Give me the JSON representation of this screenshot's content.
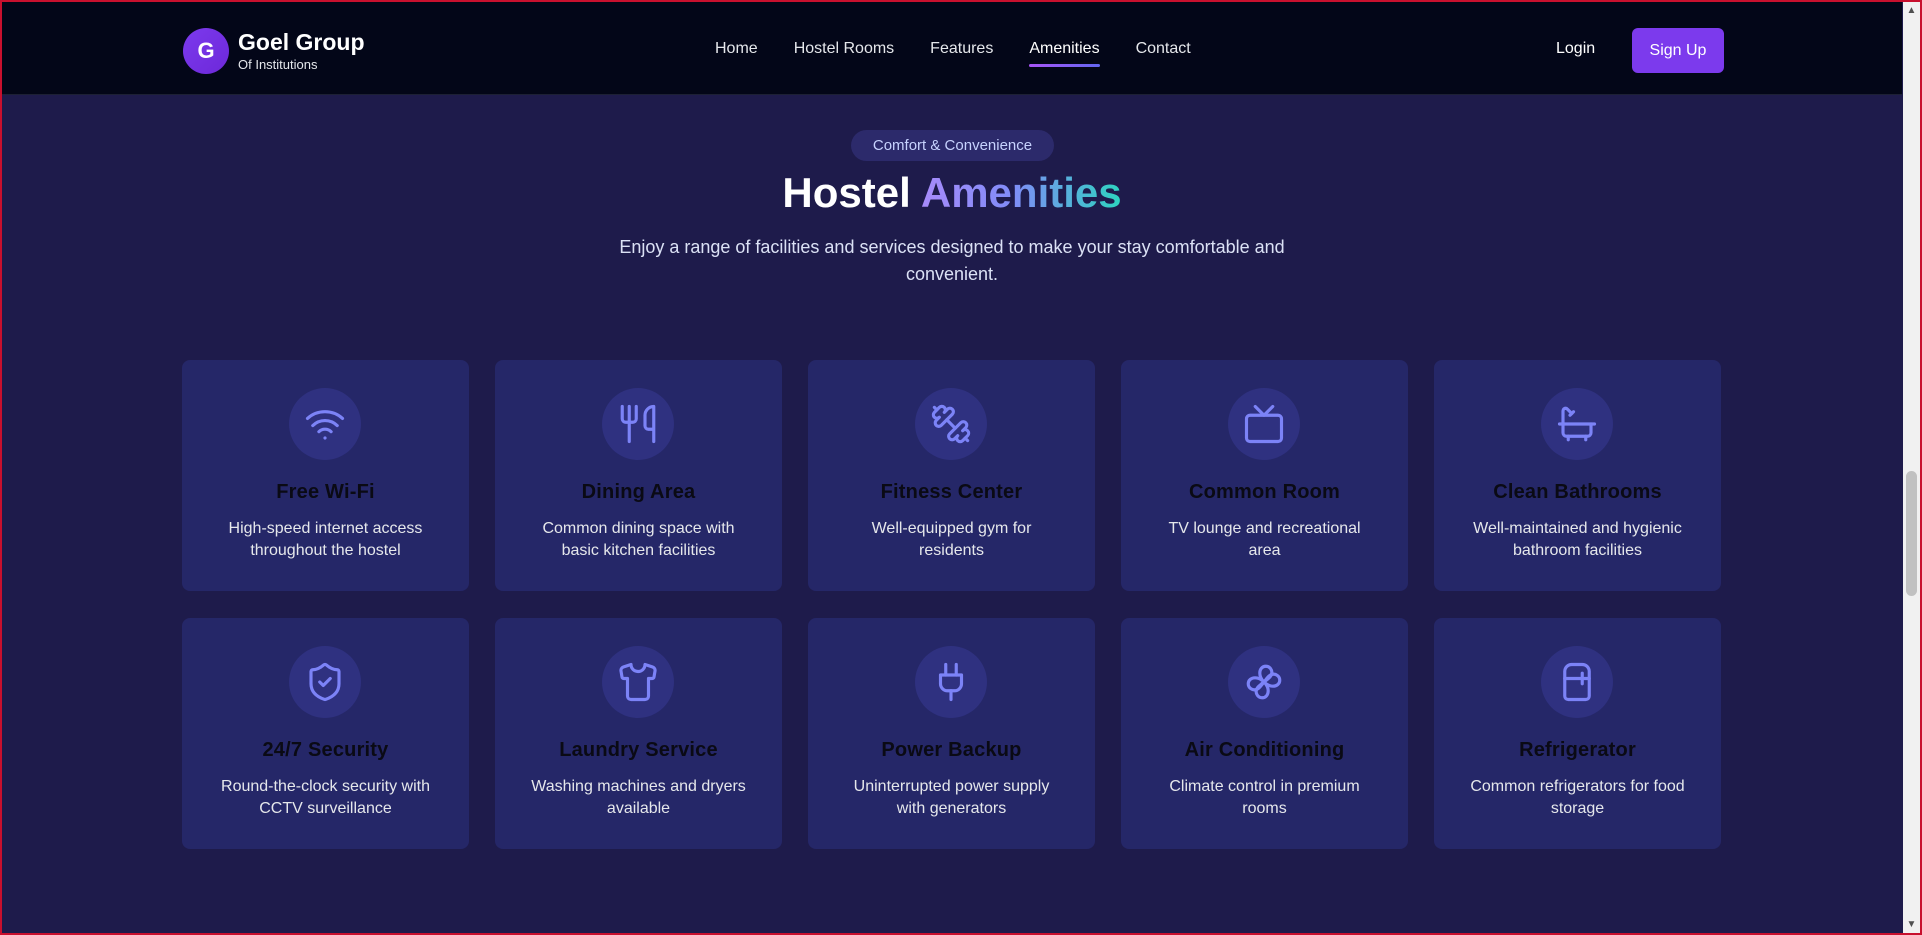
{
  "brand": {
    "initial": "G",
    "name": "Goel Group",
    "subtitle": "Of Institutions"
  },
  "nav": {
    "links": [
      {
        "label": "Home",
        "active": false
      },
      {
        "label": "Hostel Rooms",
        "active": false
      },
      {
        "label": "Features",
        "active": false
      },
      {
        "label": "Amenities",
        "active": true
      },
      {
        "label": "Contact",
        "active": false
      }
    ],
    "login_label": "Login",
    "signup_label": "Sign Up"
  },
  "section": {
    "badge": "Comfort & Convenience",
    "title_plain": "Hostel",
    "title_accent": "Amenities",
    "description": "Enjoy a range of facilities and services designed to make your stay comfortable and convenient."
  },
  "amenities": [
    {
      "icon": "wifi-icon",
      "title": "Free Wi-Fi",
      "description": "High-speed internet access throughout the hostel"
    },
    {
      "icon": "utensils-icon",
      "title": "Dining Area",
      "description": "Common dining space with basic kitchen facilities"
    },
    {
      "icon": "dumbbell-icon",
      "title": "Fitness Center",
      "description": "Well-equipped gym for residents"
    },
    {
      "icon": "tv-icon",
      "title": "Common Room",
      "description": "TV lounge and recreational area"
    },
    {
      "icon": "bath-icon",
      "title": "Clean Bathrooms",
      "description": "Well-maintained and hygienic bathroom facilities"
    },
    {
      "icon": "shield-check-icon",
      "title": "24/7 Security",
      "description": "Round-the-clock security with CCTV surveillance"
    },
    {
      "icon": "shirt-icon",
      "title": "Laundry Service",
      "description": "Washing machines and dryers available"
    },
    {
      "icon": "plug-icon",
      "title": "Power Backup",
      "description": "Uninterrupted power supply with generators"
    },
    {
      "icon": "fan-icon",
      "title": "Air Conditioning",
      "description": "Climate control in premium rooms"
    },
    {
      "icon": "refrigerator-icon",
      "title": "Refrigerator",
      "description": "Common refrigerators for food storage"
    }
  ],
  "colors": {
    "page_bg": "#1e1b4b",
    "nav_bg": "#030618",
    "card_bg": "#252768",
    "accent": "#7c3aed",
    "icon_color": "#7c83f7"
  }
}
